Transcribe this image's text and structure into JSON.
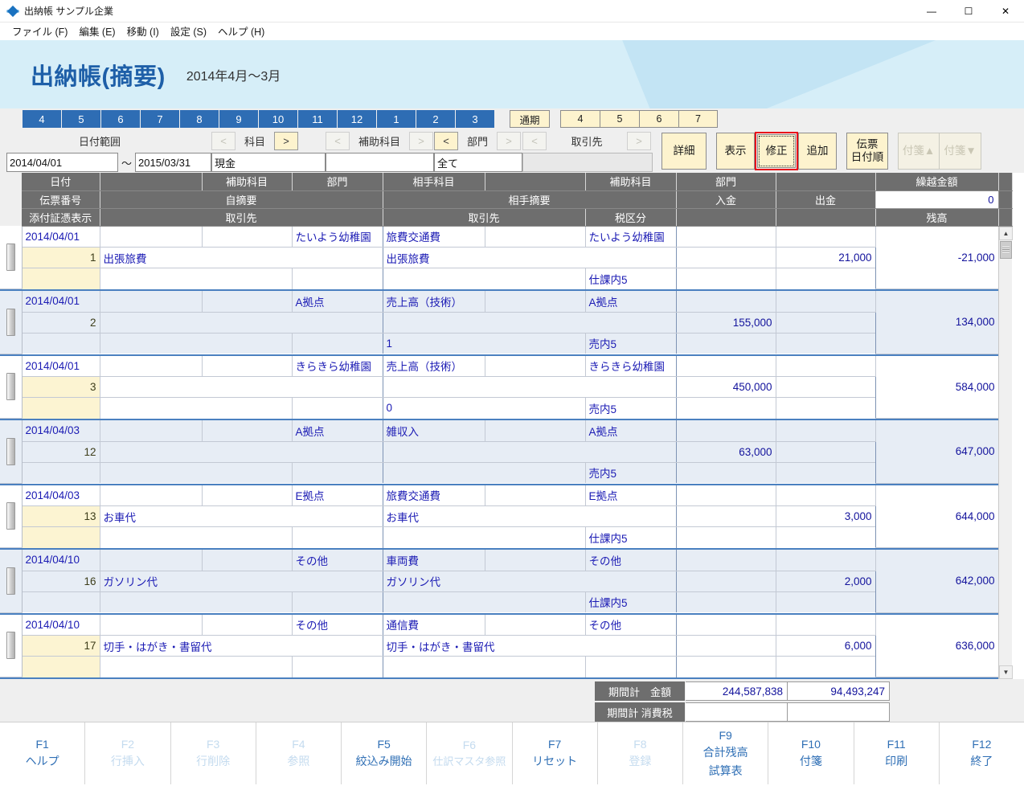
{
  "window": {
    "title": "出納帳 サンプル企業",
    "minimize": "—",
    "maximize": "☐",
    "close": "✕"
  },
  "menubar": {
    "items": [
      {
        "label": "ファイル (F)"
      },
      {
        "label": "編集 (E)"
      },
      {
        "label": "移動 (I)"
      },
      {
        "label": "設定 (S)"
      },
      {
        "label": "ヘルプ (H)"
      }
    ]
  },
  "banner": {
    "title": "出納帳(摘要)",
    "subtitle": "2014年4月〜3月"
  },
  "toolbar": {
    "months": [
      "4",
      "5",
      "6",
      "7",
      "8",
      "9",
      "10",
      "11",
      "12",
      "1",
      "2",
      "3"
    ],
    "period_button": "通期",
    "quarters": [
      "4",
      "5",
      "6",
      "7"
    ],
    "filters": {
      "date_range_label": "日付範囲",
      "date_from": "2014/04/01",
      "date_tilde": "〜",
      "date_to": "2015/03/31",
      "kamoku_label": "科目",
      "kamoku_prev": "<",
      "kamoku_next": ">",
      "kamoku_value": "現金",
      "hojo_label": "補助科目",
      "hojo_prev": "<",
      "hojo_next": ">",
      "hojo_value": "",
      "bumon_label": "部門",
      "bumon_prev": "<",
      "bumon_next": ">",
      "bumon_value": "全て",
      "torihikisaki_label": "取引先",
      "torihikisaki_prev": "<",
      "torihikisaki_next": ">",
      "torihikisaki_value": ""
    },
    "buttons": {
      "detail": "詳細",
      "display": "表示",
      "modify": "修正",
      "add": "追加",
      "slip_order_line1": "伝票",
      "slip_order_line2": "日付順",
      "tag_up": "付箋▲",
      "tag_down": "付箋▼"
    }
  },
  "grid": {
    "headers": {
      "row1": [
        "日付",
        "",
        "補助科目",
        "部門",
        "相手科目",
        "",
        "補助科目",
        "部門",
        "",
        "",
        "繰越金額"
      ],
      "row2": [
        "伝票番号",
        "自摘要",
        "相手摘要",
        "入金",
        "出金"
      ],
      "row3": [
        "添付証憑表示",
        "取引先",
        "取引先",
        "税区分",
        "",
        "",
        "残高"
      ],
      "carryover_value": "0"
    },
    "rows": [
      {
        "date": "2014/04/01",
        "slip_no": "1",
        "kamoku": "",
        "hojo": "",
        "bumon": "たいよう幼稚園",
        "jitekiyou": "出張旅費",
        "torihikisaki": "",
        "aite_kamoku": "旅費交通費",
        "aite_hojo": "",
        "aite_bumon": "たいよう幼稚園",
        "aite_tekiyou": "出張旅費",
        "aite_torihikisaki": "",
        "zeikubun": "仕課内5",
        "nyukin": "",
        "shukkin": "21,000",
        "zandaka": "-21,000"
      },
      {
        "date": "2014/04/01",
        "slip_no": "2",
        "kamoku": "",
        "hojo": "",
        "bumon": "A拠点",
        "jitekiyou": "",
        "torihikisaki": "",
        "aite_kamoku": "売上高（技術）",
        "aite_hojo": "",
        "aite_bumon": "A拠点",
        "aite_tekiyou": "",
        "aite_torihikisaki": "1",
        "zeikubun": "売内5",
        "nyukin": "155,000",
        "shukkin": "",
        "zandaka": "134,000"
      },
      {
        "date": "2014/04/01",
        "slip_no": "3",
        "kamoku": "",
        "hojo": "",
        "bumon": "きらきら幼稚園",
        "jitekiyou": "",
        "torihikisaki": "",
        "aite_kamoku": "売上高（技術）",
        "aite_hojo": "",
        "aite_bumon": "きらきら幼稚園",
        "aite_tekiyou": "",
        "aite_torihikisaki": "0",
        "zeikubun": "売内5",
        "nyukin": "450,000",
        "shukkin": "",
        "zandaka": "584,000"
      },
      {
        "date": "2014/04/03",
        "slip_no": "12",
        "kamoku": "",
        "hojo": "",
        "bumon": "A拠点",
        "jitekiyou": "",
        "torihikisaki": "",
        "aite_kamoku": "雑収入",
        "aite_hojo": "",
        "aite_bumon": "A拠点",
        "aite_tekiyou": "",
        "aite_torihikisaki": "",
        "zeikubun": "売内5",
        "nyukin": "63,000",
        "shukkin": "",
        "zandaka": "647,000"
      },
      {
        "date": "2014/04/03",
        "slip_no": "13",
        "kamoku": "",
        "hojo": "",
        "bumon": "E拠点",
        "jitekiyou": "お車代",
        "torihikisaki": "",
        "aite_kamoku": "旅費交通費",
        "aite_hojo": "",
        "aite_bumon": "E拠点",
        "aite_tekiyou": "お車代",
        "aite_torihikisaki": "",
        "zeikubun": "仕課内5",
        "nyukin": "",
        "shukkin": "3,000",
        "zandaka": "644,000"
      },
      {
        "date": "2014/04/10",
        "slip_no": "16",
        "kamoku": "",
        "hojo": "",
        "bumon": "その他",
        "jitekiyou": "ガソリン代",
        "torihikisaki": "",
        "aite_kamoku": "車両費",
        "aite_hojo": "",
        "aite_bumon": "その他",
        "aite_tekiyou": "ガソリン代",
        "aite_torihikisaki": "",
        "zeikubun": "仕課内5",
        "nyukin": "",
        "shukkin": "2,000",
        "zandaka": "642,000"
      },
      {
        "date": "2014/04/10",
        "slip_no": "17",
        "kamoku": "",
        "hojo": "",
        "bumon": "その他",
        "jitekiyou": "切手・はがき・書留代",
        "torihikisaki": "",
        "aite_kamoku": "通信費",
        "aite_hojo": "",
        "aite_bumon": "その他",
        "aite_tekiyou": "切手・はがき・書留代",
        "aite_torihikisaki": "",
        "zeikubun": "",
        "nyukin": "",
        "shukkin": "6,000",
        "zandaka": "636,000"
      }
    ]
  },
  "totals": {
    "amount_label": "期間計　金額",
    "amount_nyukin": "244,587,838",
    "amount_shukkin": "94,493,247",
    "tax_label": "期間計 消費税",
    "tax_nyukin": "",
    "tax_shukkin": ""
  },
  "fkeys": [
    {
      "num": "F1",
      "label": "ヘルプ",
      "enabled": true
    },
    {
      "num": "F2",
      "label": "行挿入",
      "enabled": false
    },
    {
      "num": "F3",
      "label": "行削除",
      "enabled": false
    },
    {
      "num": "F4",
      "label": "参照",
      "enabled": false
    },
    {
      "num": "F5",
      "label": "絞込み開始",
      "enabled": true
    },
    {
      "num": "F6",
      "label": "仕訳マスタ参照",
      "enabled": false
    },
    {
      "num": "F7",
      "label": "リセット",
      "enabled": true
    },
    {
      "num": "F8",
      "label": "登録",
      "enabled": false
    },
    {
      "num": "F9",
      "label": "合計残高\n試算表",
      "enabled": true
    },
    {
      "num": "F10",
      "label": "付箋",
      "enabled": true
    },
    {
      "num": "F11",
      "label": "印刷",
      "enabled": true
    },
    {
      "num": "F12",
      "label": "終了",
      "enabled": true
    }
  ],
  "colors": {
    "accent_blue": "#2e6db4",
    "banner_bg": "#d6eef8",
    "button_cream": "#fdf3ce",
    "header_grey": "#6e6e6e",
    "focus_red": "#e8131a",
    "text_blue": "#1b1bb4"
  }
}
